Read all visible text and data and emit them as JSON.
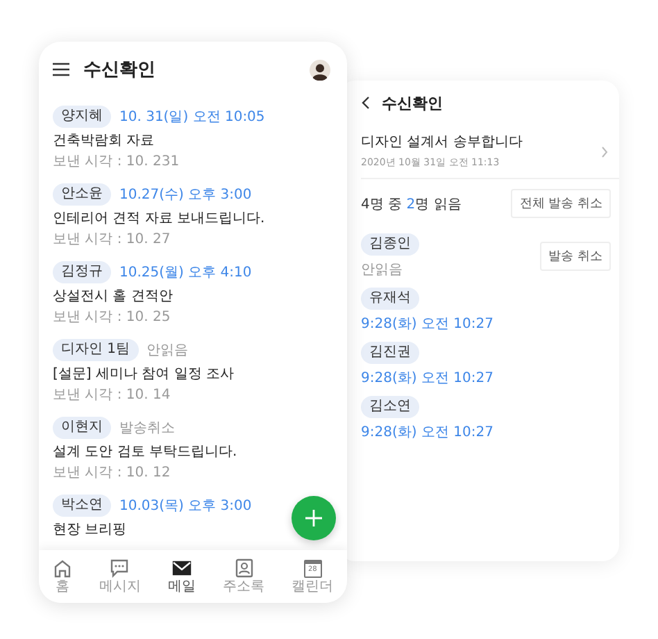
{
  "inbox": {
    "title": "수신확인",
    "messages": [
      {
        "sender": "양지혜",
        "kind": "time",
        "status": "10. 31(일) 오전 10:05",
        "subject": "건축박람회 자료",
        "sent_time": "보낸 시각 : 10. 231"
      },
      {
        "sender": "안소윤",
        "kind": "time",
        "status": "10.27(수) 오후 3:00",
        "subject": "인테리어 견적 자료 보내드립니다.",
        "sent_time": "보낸 시각 : 10. 27"
      },
      {
        "sender": "김정규",
        "kind": "time",
        "status": "10.25(월) 오후 4:10",
        "subject": "상설전시 홀 견적안",
        "sent_time": "보낸 시각 : 10. 25"
      },
      {
        "sender": "디자인 1팀",
        "kind": "note",
        "status": "안읽음",
        "subject": "[설문] 세미나 참여 일정 조사",
        "sent_time": "보낸 시각 : 10. 14"
      },
      {
        "sender": "이현지",
        "kind": "note",
        "status": "발송취소",
        "subject": "설계 도안 검토 부탁드립니다.",
        "sent_time": "보낸 시각 : 10. 12"
      },
      {
        "sender": "박소연",
        "kind": "time",
        "status": "10.03(목) 오후 3:00",
        "subject": "현장 브리핑"
      }
    ],
    "nav": [
      {
        "kind": "home",
        "label": "홈",
        "selected": false
      },
      {
        "kind": "chat",
        "label": "메시지",
        "selected": false
      },
      {
        "kind": "mail",
        "label": "메일",
        "selected": true
      },
      {
        "kind": "contacts",
        "label": "주소록",
        "selected": false
      },
      {
        "kind": "calendar",
        "label": "캘린더",
        "selected": false,
        "date": "28"
      }
    ]
  },
  "detail": {
    "title": "수신확인",
    "subject": "디자인 설계서 송부합니다",
    "date": "2020년 10월 31일 오전 11:13",
    "read_prefix": "4명 중",
    "read_count": "2",
    "read_suffix": "명 읽음",
    "cancel_all_button": "전체 발송 취소",
    "recipients": [
      {
        "name": "김종인",
        "kind": "unread",
        "status": "안읽음",
        "button": "발송 취소"
      },
      {
        "name": "유재석",
        "kind": "read",
        "status": "9:28(화) 오전 10:27"
      },
      {
        "name": "김진권",
        "kind": "read",
        "status": "9:28(화) 오전 10:27"
      },
      {
        "name": "김소연",
        "kind": "read",
        "status": "9:28(화) 오전 10:27"
      }
    ]
  }
}
